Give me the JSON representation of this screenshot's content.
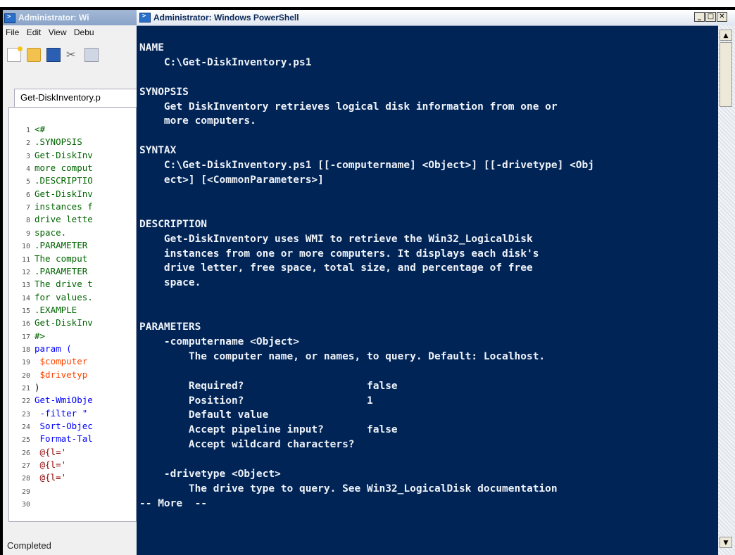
{
  "ise": {
    "title": "Administrator: Wi",
    "menu": [
      "File",
      "Edit",
      "View",
      "Debu"
    ],
    "tab_label": "Get-DiskInventory.p",
    "status": "Completed",
    "code": [
      {
        "n": "1",
        "t": "<#",
        "k": "comment"
      },
      {
        "n": "2",
        "t": ".SYNOPSIS",
        "k": "comment"
      },
      {
        "n": "3",
        "t": "Get-DiskInv",
        "k": "comment"
      },
      {
        "n": "4",
        "t": "more comput",
        "k": "comment"
      },
      {
        "n": "5",
        "t": ".DESCRIPTIO",
        "k": "comment"
      },
      {
        "n": "6",
        "t": "Get-DiskInv",
        "k": "comment"
      },
      {
        "n": "7",
        "t": "instances f",
        "k": "comment"
      },
      {
        "n": "8",
        "t": "drive lette",
        "k": "comment"
      },
      {
        "n": "9",
        "t": "space.",
        "k": "comment"
      },
      {
        "n": "10",
        "t": ".PARAMETER",
        "k": "comment"
      },
      {
        "n": "11",
        "t": "The comput",
        "k": "comment"
      },
      {
        "n": "12",
        "t": ".PARAMETER",
        "k": "comment"
      },
      {
        "n": "13",
        "t": "The drive t",
        "k": "comment"
      },
      {
        "n": "14",
        "t": "for values.",
        "k": "comment"
      },
      {
        "n": "15",
        "t": ".EXAMPLE",
        "k": "comment"
      },
      {
        "n": "16",
        "t": "Get-DiskInv",
        "k": "comment"
      },
      {
        "n": "17",
        "t": "#>",
        "k": "comment"
      },
      {
        "n": "18",
        "t": "param (",
        "k": "cmd"
      },
      {
        "n": "19",
        "t": "  $computer",
        "k": "var"
      },
      {
        "n": "20",
        "t": "  $drivetyp",
        "k": "var"
      },
      {
        "n": "21",
        "t": ")",
        "k": "plain"
      },
      {
        "n": "22",
        "t": "Get-WmiObje",
        "k": "cmd"
      },
      {
        "n": "23",
        "t": " -filter \"",
        "k": "cmd"
      },
      {
        "n": "24",
        "t": " Sort-Objec",
        "k": "cmd"
      },
      {
        "n": "25",
        "t": " Format-Tal",
        "k": "cmd"
      },
      {
        "n": "26",
        "t": "     @{l='",
        "k": "str"
      },
      {
        "n": "27",
        "t": "     @{l='",
        "k": "str"
      },
      {
        "n": "28",
        "t": "     @{l='",
        "k": "str"
      },
      {
        "n": "29",
        "t": "",
        "k": "plain"
      },
      {
        "n": "30",
        "t": "",
        "k": "plain"
      }
    ]
  },
  "console": {
    "title": "Administrator: Windows PowerShell",
    "lines": [
      "",
      "NAME",
      "    C:\\Get-DiskInventory.ps1",
      "",
      "SYNOPSIS",
      "    Get DiskInventory retrieves logical disk information from one or",
      "    more computers.",
      "",
      "SYNTAX",
      "    C:\\Get-DiskInventory.ps1 [[-computername] <Object>] [[-drivetype] <Obj",
      "    ect>] [<CommonParameters>]",
      "",
      "",
      "DESCRIPTION",
      "    Get-DiskInventory uses WMI to retrieve the Win32_LogicalDisk",
      "    instances from one or more computers. It displays each disk's",
      "    drive letter, free space, total size, and percentage of free",
      "    space.",
      "",
      "",
      "PARAMETERS",
      "    -computername <Object>",
      "        The computer name, or names, to query. Default: Localhost.",
      "",
      "        Required?                    false",
      "        Position?                    1",
      "        Default value",
      "        Accept pipeline input?       false",
      "        Accept wildcard characters?",
      "",
      "    -drivetype <Object>",
      "        The drive type to query. See Win32_LogicalDisk documentation",
      "-- More  --"
    ]
  }
}
